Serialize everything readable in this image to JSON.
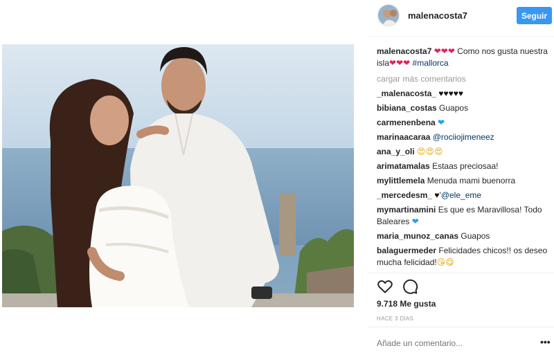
{
  "post": {
    "username": "malenacosta7",
    "follow_label": "Seguir",
    "caption": {
      "user": "malenacosta7",
      "hearts_1": "❤❤❤",
      "text": " Como nos gusta nuestra isla",
      "hearts_2": "❤❤❤",
      "hashtag": "#mallorca"
    },
    "load_more": "cargar más comentarios",
    "comments": [
      {
        "user": "_malenacosta_",
        "text": "",
        "emoji": "♥♥♥♥♥",
        "emoji_kind": "black"
      },
      {
        "user": "bibiana_costas",
        "text": "Guapos",
        "emoji": "",
        "emoji_kind": ""
      },
      {
        "user": "carmenenbena",
        "text": "",
        "emoji": "❤",
        "emoji_kind": "blue"
      },
      {
        "user": "marinaacaraa",
        "text": "",
        "mention": "@rociiojimeneez",
        "emoji": "",
        "emoji_kind": ""
      },
      {
        "user": "ana_y_oli",
        "text": "",
        "emoji": "😍😍😍",
        "emoji_kind": "face"
      },
      {
        "user": "arimatamalas",
        "text": "Estaas preciosaa!",
        "emoji": "",
        "emoji_kind": ""
      },
      {
        "user": "mylittlemela",
        "text": "Menuda mami buenorra",
        "emoji": "",
        "emoji_kind": ""
      },
      {
        "user": "_mercedesm_",
        "text": "",
        "emoji": "♥",
        "emoji_kind": "black",
        "mention": "@ele_eme",
        "prefix_after_emoji": "'"
      },
      {
        "user": "mymartinamini",
        "text": "Es que es Maravillosa! Todo Baleares",
        "emoji": "❤",
        "emoji_kind": "blue"
      },
      {
        "user": "maria_munoz_canas",
        "text": "Guapos",
        "emoji": "",
        "emoji_kind": ""
      },
      {
        "user": "balaguermeder",
        "text": "Felicidades chicos!! os deseo mucha felicidad!",
        "emoji": "😘😋",
        "emoji_kind": "face"
      }
    ],
    "likes": "9.718 Me gusta",
    "time": "HACE 3 DÍAS",
    "add_comment_placeholder": "Añade un comentario...",
    "more_label": "•••",
    "icons": {
      "like": "heart-outline-icon",
      "comment": "speech-bubble-icon"
    },
    "colors": {
      "follow": "#3897f0",
      "hashtag": "#003569",
      "muted": "#999999"
    }
  }
}
